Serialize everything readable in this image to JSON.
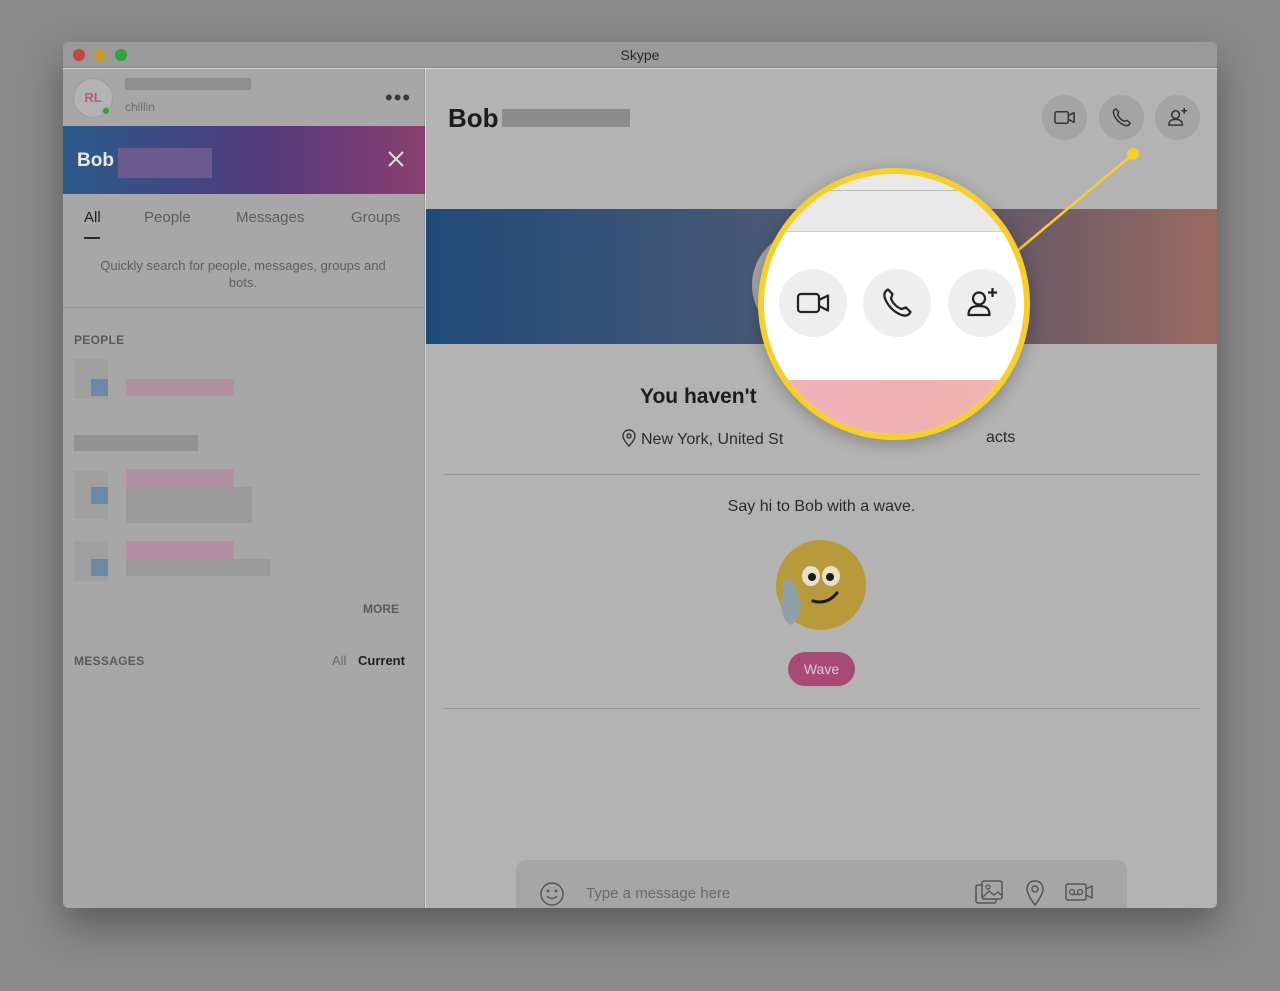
{
  "window": {
    "title": "Skype"
  },
  "profile": {
    "initials": "RL",
    "mood": "chillin"
  },
  "search": {
    "query": "Bob",
    "tabs": [
      "All",
      "People",
      "Messages",
      "Groups"
    ],
    "hint": "Quickly search for people, messages, groups and bots."
  },
  "sections": {
    "people": "PEOPLE",
    "more": "MORE",
    "messages": "MESSAGES",
    "messages_all": "All",
    "messages_current": "Current"
  },
  "chat": {
    "name": "Bob",
    "havent": "You haven't",
    "location": "New York, United St",
    "location_suffix": "acts",
    "say_hi": "Say hi to Bob with a wave.",
    "wave_label": "Wave",
    "composer_placeholder": "Type a message here"
  },
  "icons": {
    "video": "video-call-icon",
    "call": "audio-call-icon",
    "add": "add-person-icon"
  },
  "colors": {
    "highlight": "#f5cf2a",
    "wave_button": "#a94a76",
    "online": "#2fa33a"
  }
}
